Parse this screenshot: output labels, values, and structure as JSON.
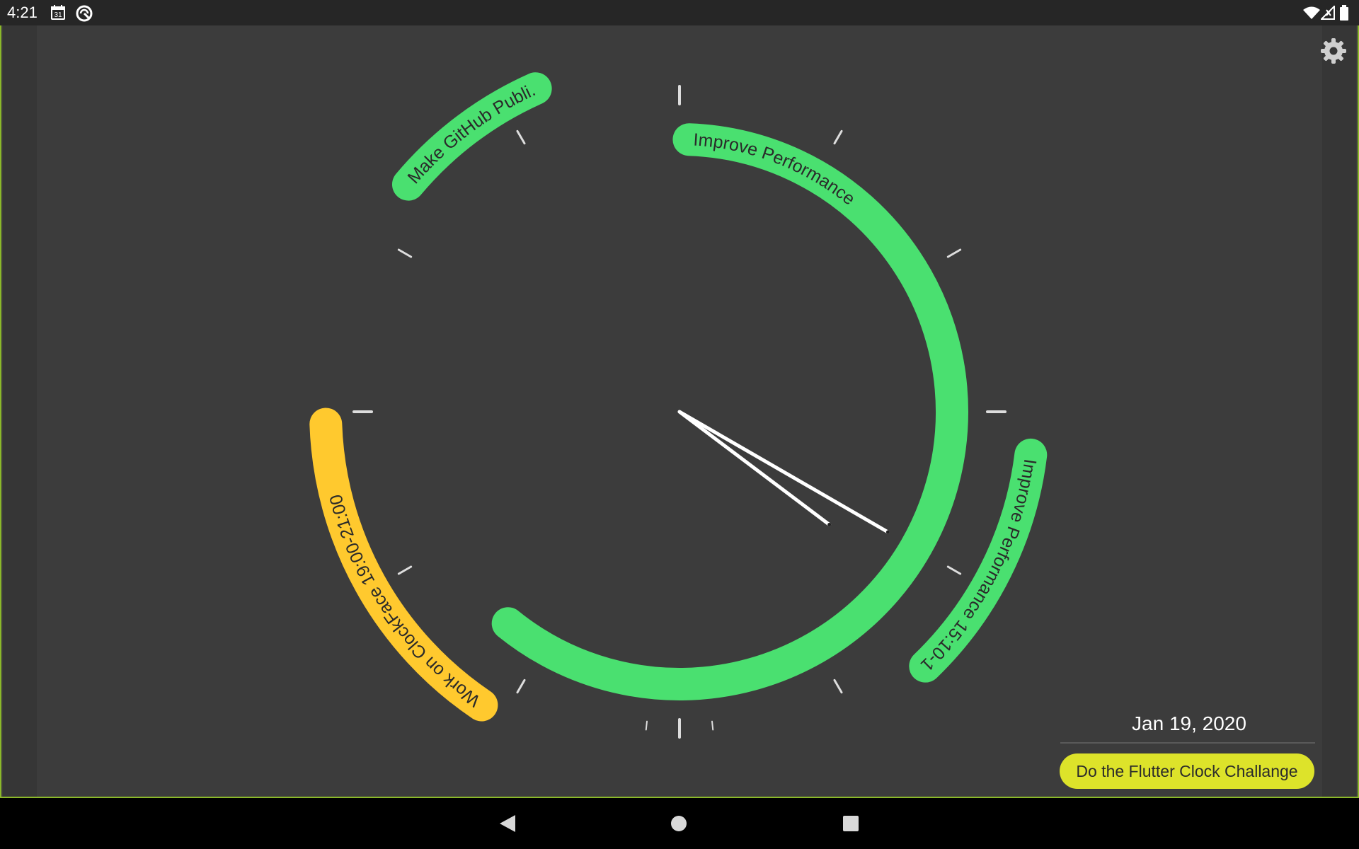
{
  "status_bar": {
    "time": "4:21",
    "calendar_day": "31",
    "left_icons": [
      "calendar-icon",
      "sync-icon"
    ],
    "right_icons": [
      "wifi-icon",
      "cell-signal-icon",
      "battery-icon"
    ]
  },
  "toolbar": {
    "settings_icon": "gear-icon"
  },
  "clock": {
    "hand_angles_deg": [
      127,
      120
    ],
    "colors": {
      "green": "#4ae070",
      "yellow": "#ffc92e",
      "hand": "#ffffff",
      "tick": "#dddddd",
      "background": "#3c3c3c"
    },
    "arcs": [
      {
        "label": "Improve Performance",
        "start_deg": 2,
        "end_deg": 219,
        "color": "#4ae070",
        "ring": "inner"
      },
      {
        "label": "Make GitHub Publi...",
        "start_deg": 310,
        "end_deg": 336,
        "color": "#4ae070",
        "ring": "outer"
      },
      {
        "label": "Improve Performance 15:10-16:...",
        "start_deg": 97,
        "end_deg": 136,
        "color": "#4ae070",
        "ring": "outer"
      },
      {
        "label": "Work on ClockFace 19:00-21:00",
        "start_deg": 214,
        "end_deg": 268,
        "color": "#ffc92e",
        "ring": "outer"
      }
    ]
  },
  "date": "Jan 19, 2020",
  "task": {
    "label": "Do the Flutter Clock Challange",
    "color": "#dde32a"
  },
  "nav": {
    "back_icon": "back-triangle-icon",
    "home_icon": "home-circle-icon",
    "recents_icon": "recents-square-icon"
  }
}
